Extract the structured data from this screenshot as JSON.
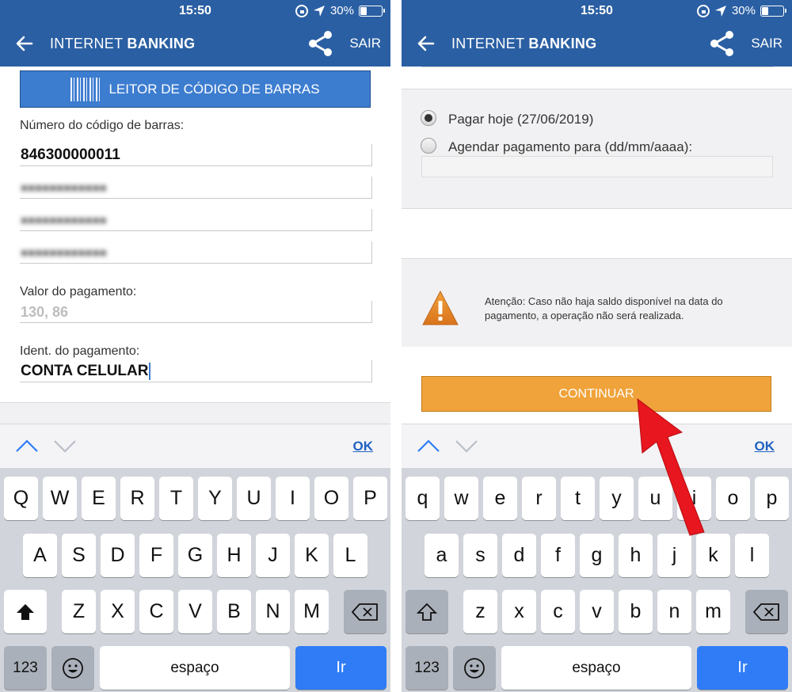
{
  "status": {
    "time": "15:50",
    "battery": "30%"
  },
  "header": {
    "title_prefix": "INTERNET ",
    "title_bold": "BANKING",
    "exit": "SAIR"
  },
  "left": {
    "barcode_button": "LEITOR DE CÓDIGO DE BARRAS",
    "barcode_label": "Número do código de barras:",
    "barcode_fields": [
      "846300000011",
      "■■■■■■■■■■■■",
      "■■■■■■■■■■■■",
      "■■■■■■■■■■■■"
    ],
    "amount_label": "Valor do pagamento:",
    "amount_value": "130, 86",
    "ident_label": "Ident. do pagamento:",
    "ident_value": "CONTA CELULAR"
  },
  "right": {
    "option_today": "Pagar hoje (27/06/2019)",
    "option_schedule": "Agendar pagamento para (dd/mm/aaaa):",
    "warning": "Atenção: Caso não haja saldo disponível na data do pagamento, a operação não será realizada.",
    "continue_button": "CONTINUAR"
  },
  "accessory": {
    "ok": "OK"
  },
  "keyboard_left": {
    "row1": [
      "Q",
      "W",
      "E",
      "R",
      "T",
      "Y",
      "U",
      "I",
      "O",
      "P"
    ],
    "row2": [
      "A",
      "S",
      "D",
      "F",
      "G",
      "H",
      "J",
      "K",
      "L"
    ],
    "row3": [
      "Z",
      "X",
      "C",
      "V",
      "B",
      "N",
      "M"
    ],
    "num": "123",
    "space": "espaço",
    "go": "Ir"
  },
  "keyboard_right": {
    "row1": [
      "q",
      "w",
      "e",
      "r",
      "t",
      "y",
      "u",
      "i",
      "o",
      "p"
    ],
    "row2": [
      "a",
      "s",
      "d",
      "f",
      "g",
      "h",
      "j",
      "k",
      "l"
    ],
    "row3": [
      "z",
      "x",
      "c",
      "v",
      "b",
      "n",
      "m"
    ],
    "num": "123",
    "space": "espaço",
    "go": "Ir"
  },
  "colors": {
    "header": "#2a5fa3",
    "accent": "#3d7dd0",
    "continue": "#f0a33a",
    "go_key": "#2f7cf6",
    "arrow": "#e8161e"
  },
  "icons": [
    "back-arrow-icon",
    "share-icon",
    "barcode-icon",
    "warning-icon",
    "chevron-up-icon",
    "chevron-down-icon",
    "shift-icon",
    "backspace-icon",
    "emoji-icon"
  ]
}
